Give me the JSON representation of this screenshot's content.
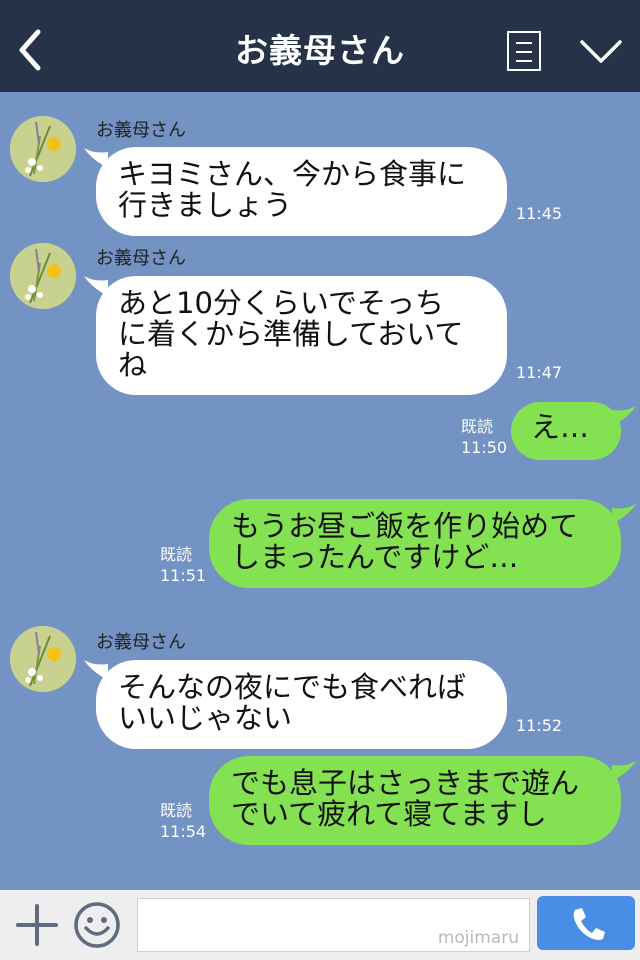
{
  "header": {
    "title": "お義母さん",
    "back_icon": "chevron-left-icon",
    "menu_icon": "list-menu-icon",
    "expand_icon": "chevron-down-icon"
  },
  "messages": [
    {
      "direction": "in",
      "sender": "お義母さん",
      "text": "キヨミさん、今から食事に\n行きましょう",
      "time": "11:45"
    },
    {
      "direction": "in",
      "sender": "お義母さん",
      "text": "あと10分くらいでそっち\nに着くから準備しておいて\nね",
      "time": "11:47"
    },
    {
      "direction": "out",
      "read": "既読",
      "text": "え…",
      "time": "11:50"
    },
    {
      "direction": "out",
      "read": "既読",
      "text": "もうお昼ご飯を作り始めて\nしまったんですけど…",
      "time": "11:51"
    },
    {
      "direction": "in",
      "sender": "お義母さん",
      "text": "そんなの夜にでも食べれば\nいいじゃない",
      "time": "11:52"
    },
    {
      "direction": "out",
      "read": "既読",
      "text": "でも息子はさっきまで遊ん\nでいて疲れて寝てますし",
      "time": "11:54"
    }
  ],
  "footer": {
    "plus_icon": "plus-icon",
    "emoji_icon": "smiley-icon",
    "input_value": "",
    "watermark": "mojimaru",
    "call_icon": "phone-icon"
  },
  "colors": {
    "header_bg": "#263248",
    "chat_bg": "#7293c3",
    "outgoing_bubble": "#84e252",
    "incoming_bubble": "#ffffff",
    "send_button": "#4a8de5"
  }
}
